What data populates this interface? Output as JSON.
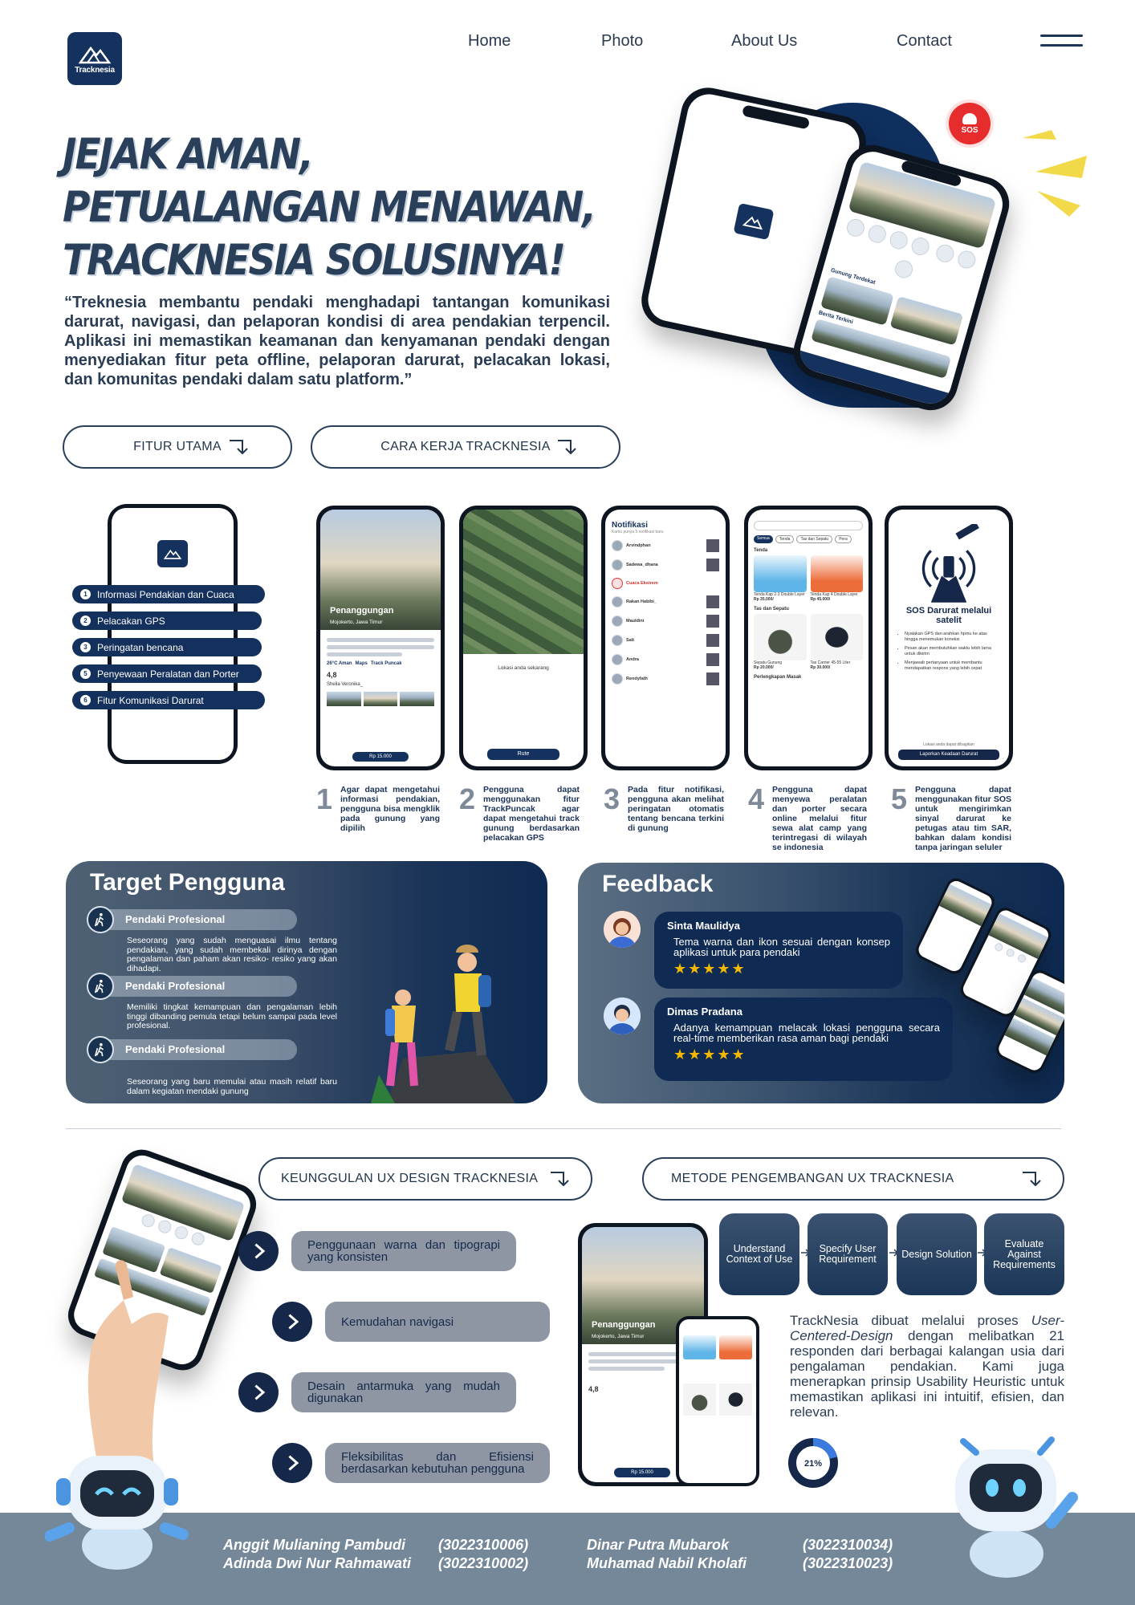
{
  "brand": {
    "name": "Tracknesia"
  },
  "nav": {
    "items": [
      "Home",
      "Photo",
      "About Us",
      "Contact"
    ]
  },
  "hero": {
    "title_lines": [
      "JEJAK AMAN,",
      "PETUALANGAN MENAWAN,",
      "TRACKNESIA SOLUSINYA!"
    ],
    "description": "“Treknesia membantu pendaki menghadapi tantangan komunikasi darurat, navigasi, dan pelaporan kondisi di area pendakian terpencil. Aplikasi ini memastikan keamanan dan kenyamanan pendaki dengan menyediakan fitur peta offline, pelaporan darurat, pelacakan lokasi, dan komunitas pendaki dalam satu platform.”",
    "btn_features": "FITUR UTAMA",
    "btn_how": "CARA KERJA TRACKNESIA",
    "sos_label": "SOS"
  },
  "hero_phone": {
    "section_nearby": "Gunung Terdekat",
    "section_news": "Berita Terkini"
  },
  "features": {
    "list": [
      {
        "n": "1",
        "label": "Informasi Pendakian dan Cuaca"
      },
      {
        "n": "2",
        "label": "Pelacakan GPS"
      },
      {
        "n": "3",
        "label": "Peringatan bencana"
      },
      {
        "n": "5",
        "label": "Penyewaan Peralatan dan Porter"
      },
      {
        "n": "6",
        "label": "Fitur Komunikasi Darurat"
      }
    ],
    "screens": {
      "s1_title": "Penanggungan",
      "s1_loc": "Mojokerto, Jawa Timur",
      "s1_stats": [
        "26°C Aman",
        "Maps",
        "Track Puncak"
      ],
      "s1_rating": "4,8",
      "s1_reviewer": "Sheila Veronika_",
      "s1_price": "Rp 15.000",
      "s2_loc": "Lokasi anda sekarang",
      "s2_btn": "Rute",
      "s3_title": "Notifikasi",
      "s3_subtitle": "Kamu punya 5 notifikasi baru",
      "s3_names": [
        "Arvindphan",
        "Sadewa_dhana",
        "Cuaca Ekstrem",
        "Rakan Habibi_",
        "Mauldini",
        "Salt",
        "Andra",
        "Rendyfath"
      ],
      "s4_tabs": [
        "Semua",
        "Tenda",
        "Tas dan Sepatu",
        "Pera"
      ],
      "s4_section1": "Tenda",
      "s4_items1": [
        {
          "name": "Tenda Kap 2-3 Double Layer",
          "price": "Rp 35.000/"
        },
        {
          "name": "Tenda Kap 4 Double Layer",
          "price": "Rp 45.000/"
        }
      ],
      "s4_section2": "Tas dan Sepatu",
      "s4_items2": [
        {
          "name": "Sepatu Gunung",
          "price": "Rp 20.000/"
        },
        {
          "name": "Tas Carrier 45-55 Liter",
          "price": "Rp 30.000/"
        }
      ],
      "s4_section3": "Perlengkapan Masak",
      "s5_title": "SOS Darurat melalui satelit",
      "s5_bullets": [
        "Nyalakan GPS dan arahkan hpmu ke atas hingga menemukan koneksi",
        "Pesan akan membutuhkan waktu lebih lama untuk dikirim",
        "Menjawab pertanyaan untuk membantu mendapatkan respons yang lebih cepat"
      ],
      "s5_note": "Lokasi anda dapat dibagikan",
      "s5_btn": "Laporkan Keadaan Darurat"
    },
    "steps": [
      {
        "n": "1",
        "text": "Agar dapat mengetahui informasi pendakian, pengguna bisa mengklik pada gunung yang dipilih"
      },
      {
        "n": "2",
        "text": "Pengguna dapat menggunakan fitur TrackPuncak agar dapat mengetahui track gunung berdasarkan pelacakan GPS"
      },
      {
        "n": "3",
        "text": "Pada fitur notifikasi, pengguna akan melihat peringatan otomatis tentang bencana terkini di gunung"
      },
      {
        "n": "4",
        "text": "Pengguna dapat menyewa peralatan dan porter secara online melalui fitur sewa alat camp yang terintregasi di wilayah se indonesia"
      },
      {
        "n": "5",
        "text": "Pengguna dapat menggunakan fitur SOS untuk mengirimkan sinyal darurat ke petugas atau tim SAR, bahkan dalam kondisi tanpa jaringan seluler"
      }
    ]
  },
  "target": {
    "title": "Target Pengguna",
    "items": [
      {
        "label": "Pendaki Profesional",
        "desc": "Seseorang yang sudah menguasai ilmu tentang pendakian, yang sudah membekali dirinya dengan pengalaman dan paham akan resiko- resiko yang akan dihadapi."
      },
      {
        "label": "Pendaki Profesional",
        "desc": "Memiliki tingkat kemampuan dan pengalaman lebih tinggi dibanding pemula tetapi belum sampai pada level profesional."
      },
      {
        "label": "Pendaki Profesional",
        "desc": "Seseorang yang baru memulai atau masih relatif baru dalam kegiatan mendaki gunung"
      }
    ]
  },
  "feedback": {
    "title": "Feedback",
    "items": [
      {
        "name": "Sinta Maulidya",
        "text": "Tema warna dan ikon sesuai dengan konsep aplikasi untuk para pendaki",
        "rating": 5,
        "stars": "★★★★★"
      },
      {
        "name": "Dimas Pradana",
        "text": "Adanya kemampuan melacak lokasi pengguna secara real-time memberikan rasa aman bagi pendaki",
        "rating": 5,
        "stars": "★★★★★"
      }
    ]
  },
  "ux": {
    "title": "KEUNGGULAN UX DESIGN TRACKNESIA",
    "items": [
      "Penggunaan warna dan tipograpi yang konsisten",
      "Kemudahan navigasi",
      "Desain antarmuka yang mudah digunakan",
      "Fleksibilitas dan Efisiensi berdasarkan kebutuhan pengguna"
    ]
  },
  "method": {
    "title": "METODE PENGEMBANGAN UX TRACKNESIA",
    "steps": [
      "Understand Context of Use",
      "Specify User Requirement",
      "Design Solution",
      "Evaluate Against Requirements"
    ],
    "text_before": "TrackNesia dibuat melalui proses ",
    "text_italic": "User-Centered-Design",
    "text_after": " dengan melibatkan 21 responden dari berbagai kalangan usia dari pengalaman pendakian. Kami juga menerapkan prinsip Usability Heuristic untuk memastikan aplikasi ini intuitif, efisien, dan relevan.",
    "donut_label": "21%",
    "donut_value": 0.21
  },
  "footer": {
    "members": [
      {
        "name": "Anggit Mulianing Pambudi",
        "id": "(3022310006)"
      },
      {
        "name": "Adinda Dwi Nur Rahmawati",
        "id": "(3022310002)"
      },
      {
        "name": "Dinar Putra Mubarok",
        "id": "(3022310034)"
      },
      {
        "name": "Muhamad Nabil Kholafi",
        "id": "(3022310023)"
      }
    ]
  },
  "colors": {
    "navy": "#15325e",
    "slate": "#2a405a",
    "sos_red": "#e62c2c",
    "star": "#f5b800",
    "footer": "#74889a"
  }
}
